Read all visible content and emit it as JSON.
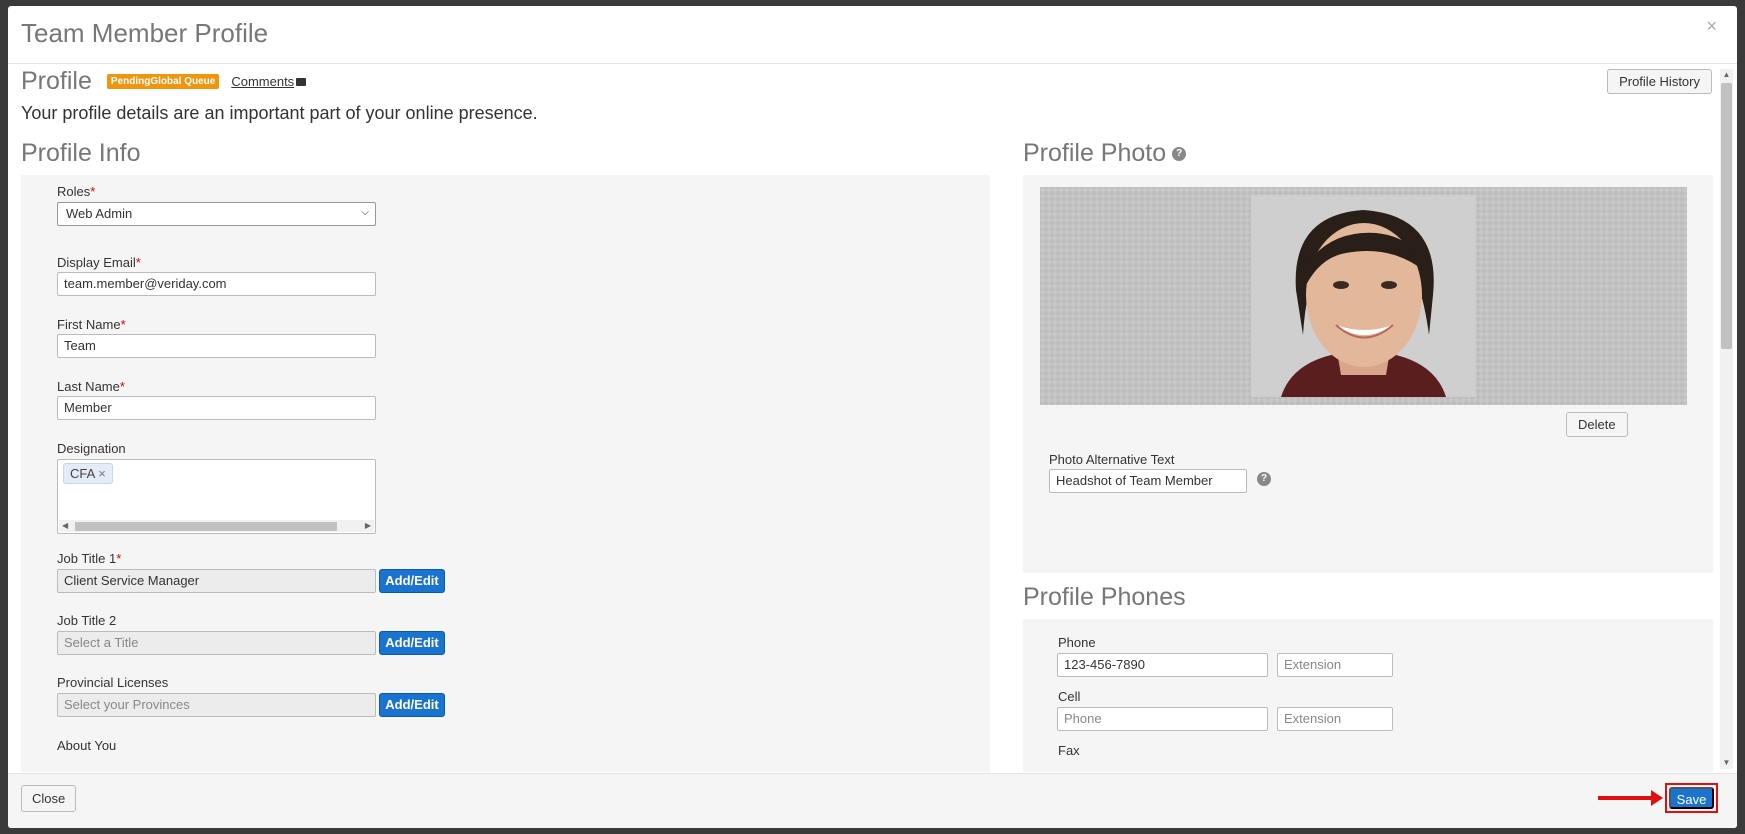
{
  "modal": {
    "title": "Team Member Profile",
    "close_glyph": "×"
  },
  "profile": {
    "heading": "Profile",
    "status_badge": "PendingGlobal Queue",
    "comments_label": "Comments",
    "history_button": "Profile History",
    "subtitle": "Your profile details are an important part of your online presence."
  },
  "profile_info": {
    "title": "Profile Info",
    "roles": {
      "label": "Roles",
      "value": "Web Admin"
    },
    "display_email": {
      "label": "Display Email",
      "value": "team.member@veriday.com"
    },
    "first_name": {
      "label": "First Name",
      "value": "Team"
    },
    "last_name": {
      "label": "Last Name",
      "value": "Member"
    },
    "designation": {
      "label": "Designation",
      "tags": [
        "CFA"
      ],
      "tag_remove": "×"
    },
    "job_title_1": {
      "label": "Job Title 1",
      "value": "Client Service Manager",
      "button": "Add/Edit"
    },
    "job_title_2": {
      "label": "Job Title 2",
      "placeholder": "Select a Title",
      "button": "Add/Edit"
    },
    "provincial_licenses": {
      "label": "Provincial Licenses",
      "placeholder": "Select your Provinces",
      "button": "Add/Edit"
    },
    "about_you": {
      "label": "About You"
    },
    "required_marker": "*"
  },
  "profile_photo": {
    "title": "Profile Photo",
    "help": "?",
    "delete_button": "Delete",
    "alt_text": {
      "label": "Photo Alternative Text",
      "value": "Headshot of Team Member"
    }
  },
  "profile_phones": {
    "title": "Profile Phones",
    "phone": {
      "label": "Phone",
      "value": "123-456-7890",
      "extension_placeholder": "Extension"
    },
    "cell": {
      "label": "Cell",
      "placeholder": "Phone",
      "extension_placeholder": "Extension"
    },
    "fax": {
      "label": "Fax"
    }
  },
  "footer": {
    "close_button": "Close",
    "save_button": "Save"
  },
  "colors": {
    "badge": "#f0950e",
    "primary_button": "#1a73cf",
    "annotation_red": "#e01010"
  }
}
